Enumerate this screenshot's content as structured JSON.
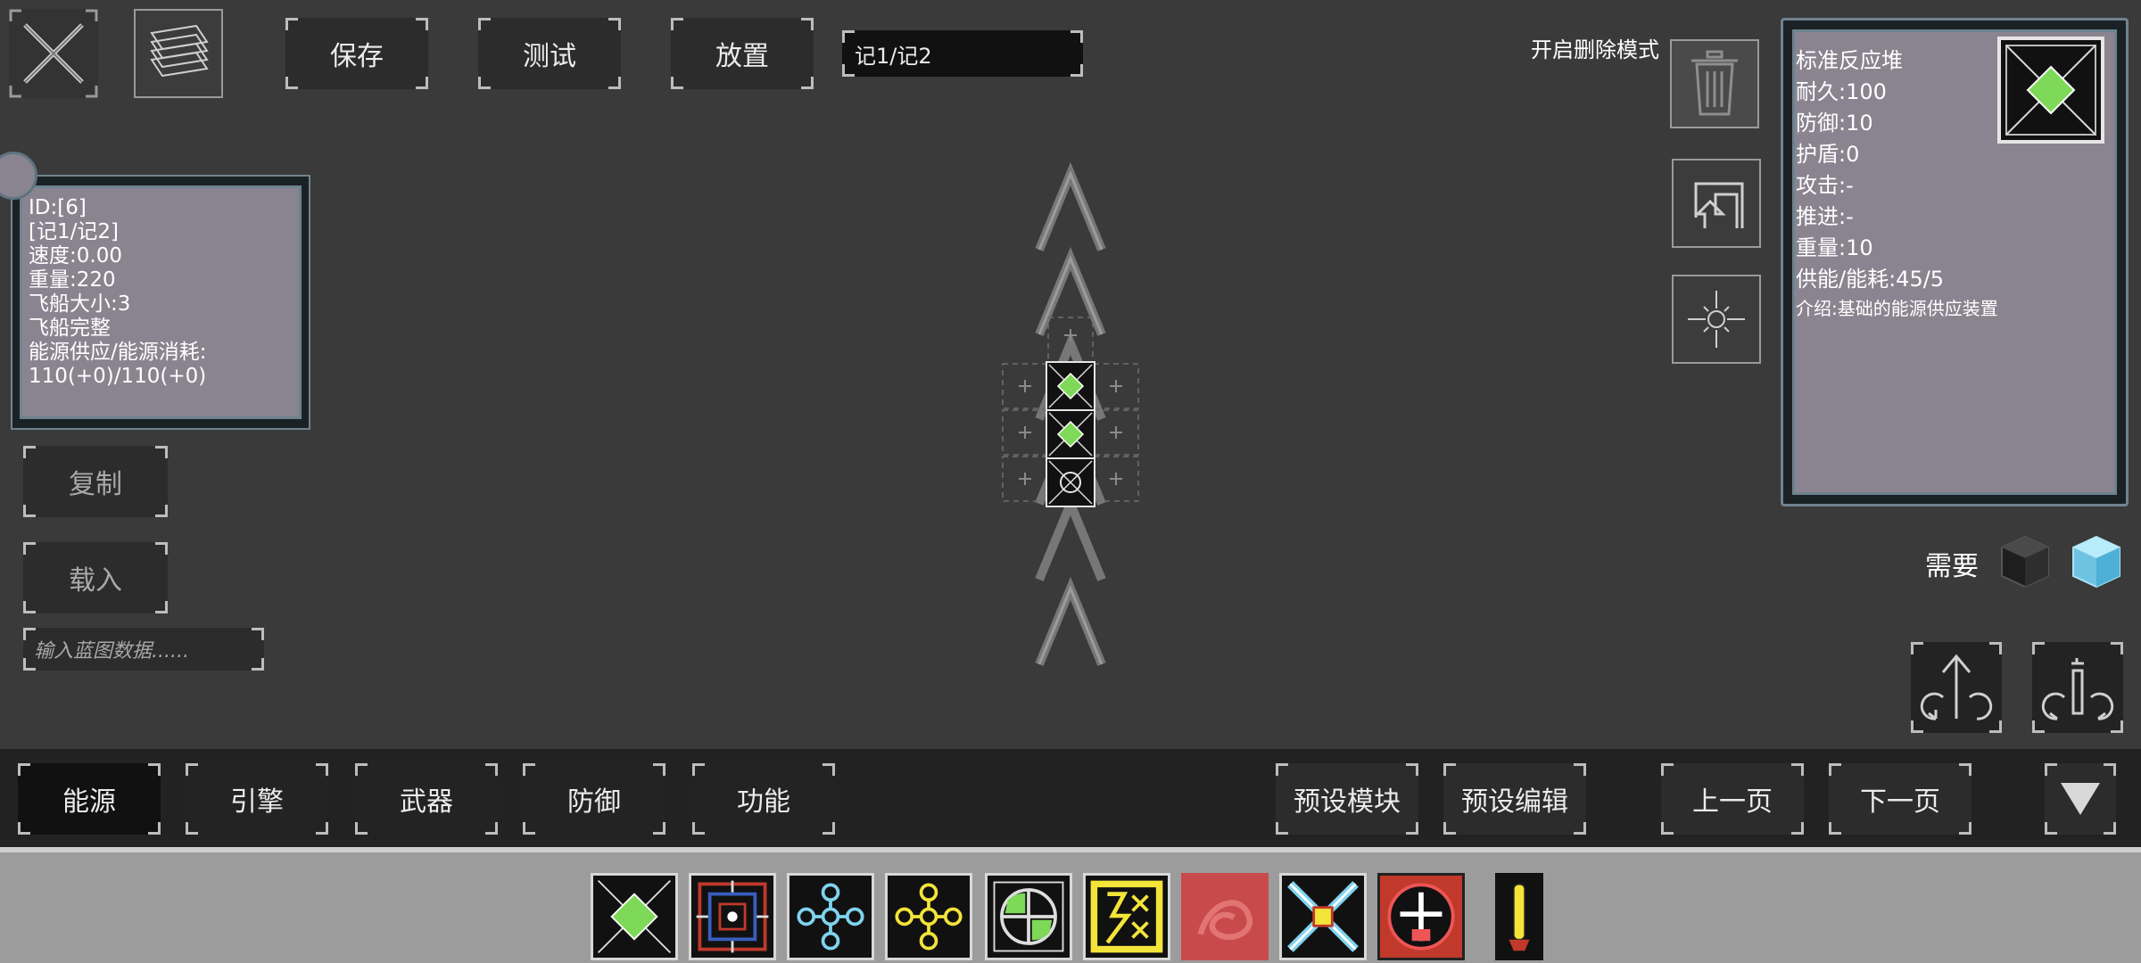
{
  "toolbar": {
    "save_label": "保存",
    "test_label": "测试",
    "place_label": "放置",
    "blueprint_name": "记1/记2"
  },
  "ship_info": {
    "lines": [
      "ID:[6]",
      "[记1/记2]",
      "速度:0.00",
      "重量:220",
      "飞船大小:3",
      "飞船完整",
      "能源供应/能源消耗:",
      "110(+0)/110(+0)"
    ]
  },
  "left_actions": {
    "copy_label": "复制",
    "load_label": "载入",
    "blueprint_placeholder": "输入蓝图数据......"
  },
  "delete_mode": {
    "label": "开启删除模式"
  },
  "module_info": {
    "name": "标准反应堆",
    "durability": "耐久:100",
    "defense": "防御:10",
    "shield": "护盾:0",
    "attack": "攻击:-",
    "thrust": "推进:-",
    "weight": "重量:10",
    "power": "供能/能耗:45/5",
    "description": "介绍:基础的能源供应装置"
  },
  "require": {
    "label": "需要"
  },
  "categories": {
    "energy": "能源",
    "engine": "引擎",
    "weapon": "武器",
    "defense": "防御",
    "function": "功能",
    "preset_module": "预设模块",
    "preset_edit": "预设编辑",
    "prev_page": "上一页",
    "next_page": "下一页"
  },
  "colors": {
    "reactor_green": "#7dd957",
    "ice_blue": "#7fd3ee",
    "yellow": "#f3e43a",
    "red": "#c0392b",
    "panel_fill": "#8a8490"
  },
  "icons": [
    "close-icon",
    "layers-icon",
    "trash-icon",
    "return-arrow-icon",
    "target-icon",
    "rotate-up-icon",
    "rotate-flip-icon",
    "down-triangle-icon",
    "dark-cube-icon",
    "ice-cube-icon"
  ]
}
